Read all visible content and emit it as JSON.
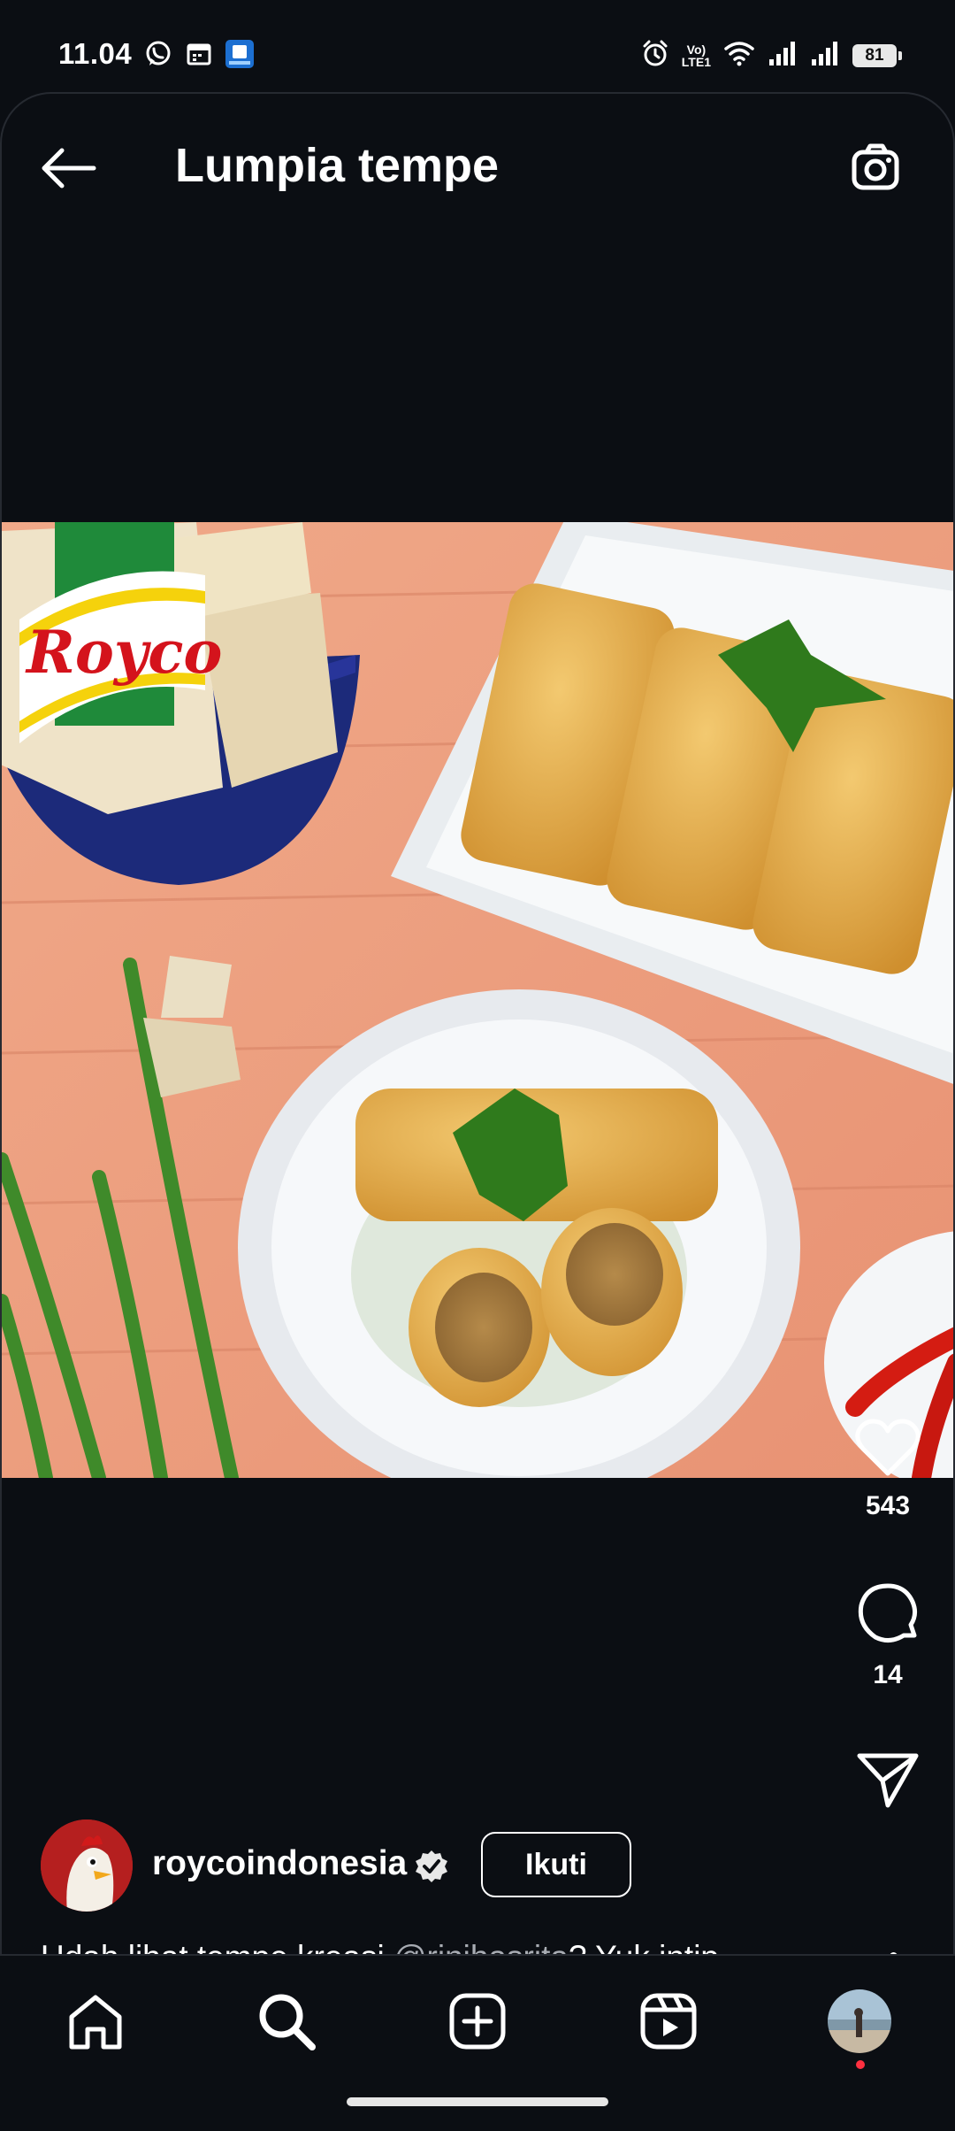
{
  "status_bar": {
    "time": "11.04",
    "battery": "81",
    "network_label": "VoLTE1",
    "left_icons": [
      "whatsapp-icon",
      "calendar-icon",
      "app-notification-icon"
    ],
    "right_icons": [
      "alarm-icon",
      "volte-icon",
      "wifi-icon",
      "signal-icon",
      "signal-icon",
      "battery-icon"
    ]
  },
  "header": {
    "title": "Lumpia tempe",
    "back_icon": "arrow-left-icon",
    "camera_icon": "camera-icon"
  },
  "post": {
    "brand_logo_text": "Royco",
    "like_count": "543",
    "comment_count": "14",
    "author": {
      "username": "roycoindonesia",
      "verified": true,
      "follow_label": "Ikuti"
    },
    "caption": {
      "before": "Udah lihat tempe kreasi ",
      "mention": "@rinihasrita",
      "after": "? Yuk intip resepnya! ..."
    }
  },
  "bottom_nav": {
    "items": [
      "home-icon",
      "search-icon",
      "create-icon",
      "reels-icon",
      "profile-avatar"
    ]
  },
  "colors": {
    "background": "#0b0e13",
    "text": "#ffffff",
    "mention": "#a8acb3",
    "notification_dot": "#ff3040"
  }
}
